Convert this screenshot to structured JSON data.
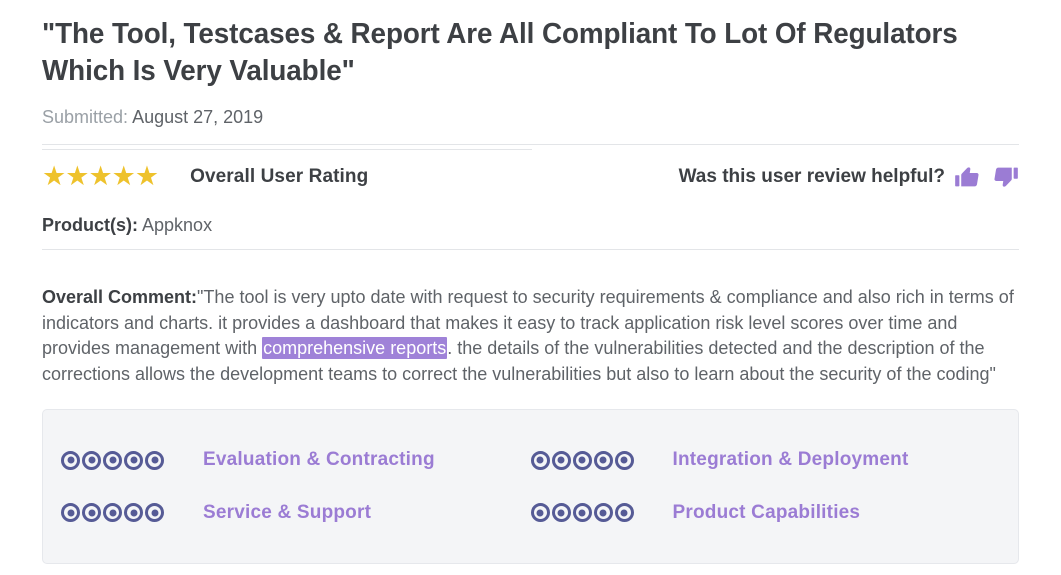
{
  "review": {
    "title": "\"The Tool, Testcases & Report Are All Compliant To Lot Of Regulators Which Is Very Valuable\"",
    "submitted_label": "Submitted:",
    "submitted_date": "August 27, 2019",
    "overall_rating_label": "Overall User Rating",
    "star_count": 5,
    "star_glyph": "★",
    "star_color": "#eec22c",
    "helpful_question": "Was this user review helpful?",
    "thumbs_up_icon": "thumbs-up-icon",
    "thumbs_down_icon": "thumbs-down-icon",
    "thumbs_color": "#9b7cd4",
    "product_label": "Product(s):",
    "product_value": "Appknox",
    "comment_label": "Overall Comment:",
    "comment_part_1": "\"The tool is very upto date with request to security requirements & compliance and also rich in terms of indicators and charts. it provides a dashboard that makes it easy to track application risk level scores over time and provides management with ",
    "comment_highlight": "comprehensive reports",
    "comment_part_2": ". the details of the vulnerabilities detected and the description of the corrections allows the development teams to correct the vulnerabilities but also to learn about the security of the coding\"",
    "highlight_color": "#9f82d8"
  },
  "scores": {
    "dot_color": "#565b96",
    "label_color": "#9b7cd4",
    "items": [
      {
        "label": "Evaluation & Contracting",
        "filled": 5,
        "total": 5
      },
      {
        "label": "Integration & Deployment",
        "filled": 5,
        "total": 5
      },
      {
        "label": "Service & Support",
        "filled": 5,
        "total": 5
      },
      {
        "label": "Product Capabilities",
        "filled": 5,
        "total": 5
      }
    ]
  }
}
